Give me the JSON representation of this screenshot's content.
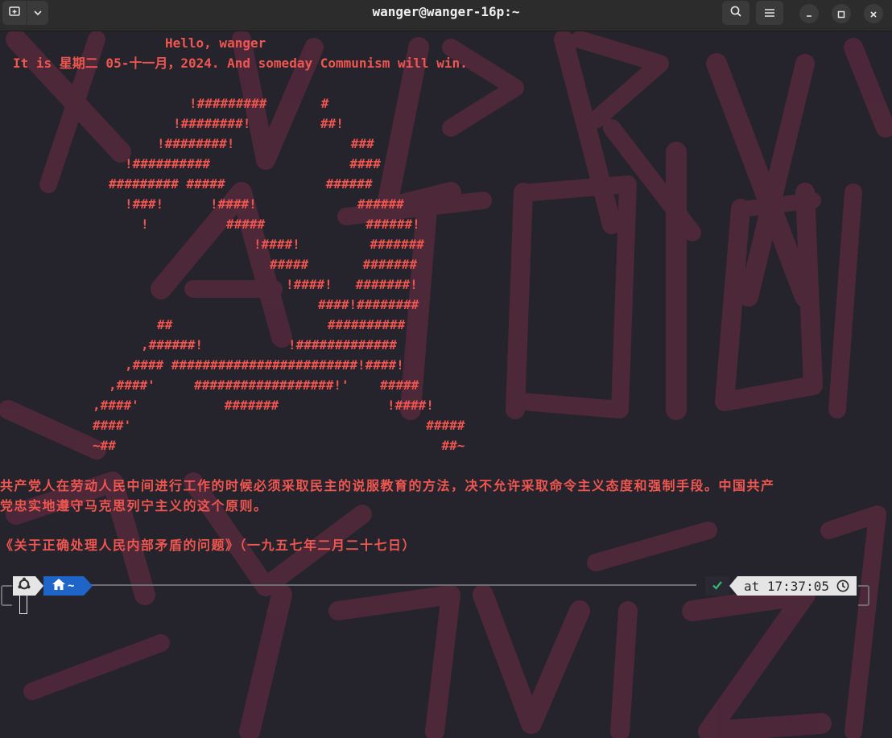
{
  "window": {
    "title": "wanger@wanger-16p:~"
  },
  "icons": {
    "new_tab": "new-tab-icon",
    "tab_menu": "chevron-down-icon",
    "search": "search-icon",
    "menu": "hamburger-menu-icon",
    "minimize": "minimize-icon",
    "maximize": "maximize-icon",
    "close": "close-icon",
    "os": "ubuntu-logo-icon",
    "home": "home-icon",
    "status_ok": "checkmark-icon",
    "clock": "clock-icon"
  },
  "colors": {
    "terminal_text": "#f0564f",
    "terminal_background": "#25232c",
    "dir_segment": "#1f65c7",
    "status_ok": "#2fbf71"
  },
  "greeting": {
    "hello": "Hello, wanger",
    "date_line": "It is 星期二 05-十一月，2024. And someday Communism will win."
  },
  "ascii_art": [
    "!#########       #",
    "!########!         ##!",
    "!########!               ###",
    "!##########                  ####",
    "######### #####             ######",
    "!###!      !####!             ######",
    "!          #####             ######!",
    "!####!         #######",
    "#####       #######",
    "!####!   #######!",
    "####!########",
    "##                    ##########",
    ",######!           !#############",
    ",#### ########################!####!",
    ",####'     ##################!'    #####",
    ",####'           #######              !####!",
    "####'                                      #####",
    "~##                                          ##~"
  ],
  "quote": {
    "line1": "共产党人在劳动人民中间进行工作的时候必须采取民主的说服教育的方法，决不允许采取命令主义态度和强制手段。中国共产",
    "line2": "党忠实地遵守马克思列宁主义的这个原则。",
    "source": "《关于正确处理人民内部矛盾的问题》（一九五七年二月二十七日）"
  },
  "prompt": {
    "dir": "~",
    "time": "at 17:37:05"
  }
}
